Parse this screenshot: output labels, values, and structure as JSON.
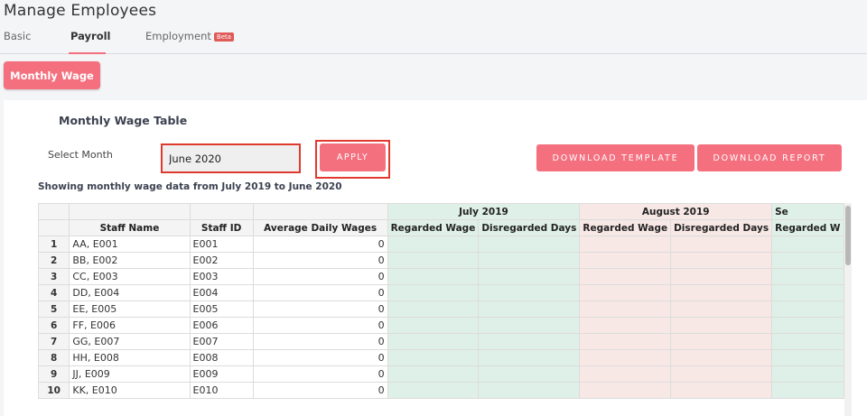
{
  "page": {
    "title": "Manage Employees"
  },
  "tabs": [
    {
      "label": "Basic"
    },
    {
      "label": "Payroll"
    },
    {
      "label": "Employment",
      "badge": "Beta"
    }
  ],
  "subnav": {
    "monthly_wage": "Monthly Wage"
  },
  "card": {
    "title": "Monthly Wage Table",
    "select_label": "Select Month",
    "month_value": "June 2020",
    "apply": "APPLY",
    "download_template": "DOWNLOAD TEMPLATE",
    "download_report": "DOWNLOAD REPORT",
    "showing": "Showing monthly wage data from July 2019 to June 2020"
  },
  "grid": {
    "month_groups": [
      "July 2019",
      "August 2019",
      "Se"
    ],
    "columns": [
      "Staff Name",
      "Staff ID",
      "Average Daily Wages",
      "Regarded Wage",
      "Disregarded Days",
      "Regarded Wage",
      "Disregarded Days",
      "Regarded W"
    ],
    "rows": [
      {
        "n": "1",
        "name": "AA, E001",
        "id": "E001",
        "avg": "0"
      },
      {
        "n": "2",
        "name": "BB, E002",
        "id": "E002",
        "avg": "0"
      },
      {
        "n": "3",
        "name": "CC, E003",
        "id": "E003",
        "avg": "0"
      },
      {
        "n": "4",
        "name": "DD, E004",
        "id": "E004",
        "avg": "0"
      },
      {
        "n": "5",
        "name": "EE, E005",
        "id": "E005",
        "avg": "0"
      },
      {
        "n": "6",
        "name": "FF, E006",
        "id": "E006",
        "avg": "0"
      },
      {
        "n": "7",
        "name": "GG, E007",
        "id": "E007",
        "avg": "0"
      },
      {
        "n": "8",
        "name": "HH, E008",
        "id": "E008",
        "avg": "0"
      },
      {
        "n": "9",
        "name": "JJ, E009",
        "id": "E009",
        "avg": "0"
      },
      {
        "n": "10",
        "name": "KK, E010",
        "id": "E010",
        "avg": "0"
      }
    ]
  },
  "colors": {
    "accent": "#f4707f",
    "highlight": "#e03a2f",
    "july": "#dff0e8",
    "august": "#f7e8e6"
  }
}
